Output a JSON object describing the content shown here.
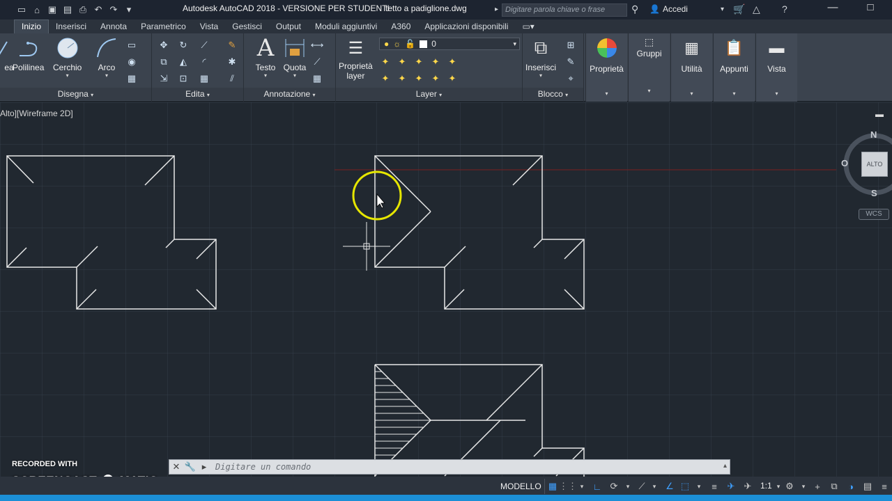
{
  "titlebar": {
    "app_title": "Autodesk AutoCAD 2018 - VERSIONE PER STUDENTI",
    "doc_title": "tetto a padiglione.dwg",
    "search_placeholder": "Digitare parola chiave o frase",
    "signin_label": "Accedi"
  },
  "tabs": [
    "Inizio",
    "Inserisci",
    "Annota",
    "Parametrico",
    "Vista",
    "Gestisci",
    "Output",
    "Moduli aggiuntivi",
    "A360",
    "Applicazioni disponibili"
  ],
  "ribbon": {
    "draw": {
      "title": "Disegna",
      "line_label": "ea",
      "polyline_label": "Polilinea",
      "circle_label": "Cerchio",
      "arc_label": "Arco"
    },
    "modify": {
      "title": "Edita"
    },
    "annotation": {
      "title": "Annotazione",
      "text_label": "Testo",
      "dimension_label": "Quota"
    },
    "layers": {
      "title": "Layer",
      "properties_label": "Proprietà\nlayer",
      "current_layer": "0"
    },
    "block": {
      "title": "Blocco",
      "insert_label": "Inserisci"
    },
    "properties_label": "Proprietà",
    "groups_label": "Gruppi",
    "utilities_label": "Utilità",
    "clipboard_label": "Appunti",
    "view_label": "Vista"
  },
  "viewport": {
    "label": "Alto][Wireframe 2D]",
    "viewcube": {
      "north": "N",
      "south": "S",
      "west": "O",
      "face": "ALTO",
      "wcs": "WCS"
    }
  },
  "commandline": {
    "placeholder": "Digitare un comando"
  },
  "watermark": {
    "line1": "RECORDED WITH",
    "line2": "SCREENCAST",
    "line3": "MATIC"
  },
  "statusbar": {
    "model_label": "MODELLO",
    "scale_label": "1:1"
  },
  "colors": {
    "background": "#212830",
    "ribbon": "#3b434e",
    "accent": "#3fa0ff",
    "lines": "#e8e8e8",
    "cursor_ring": "#e6e600"
  }
}
